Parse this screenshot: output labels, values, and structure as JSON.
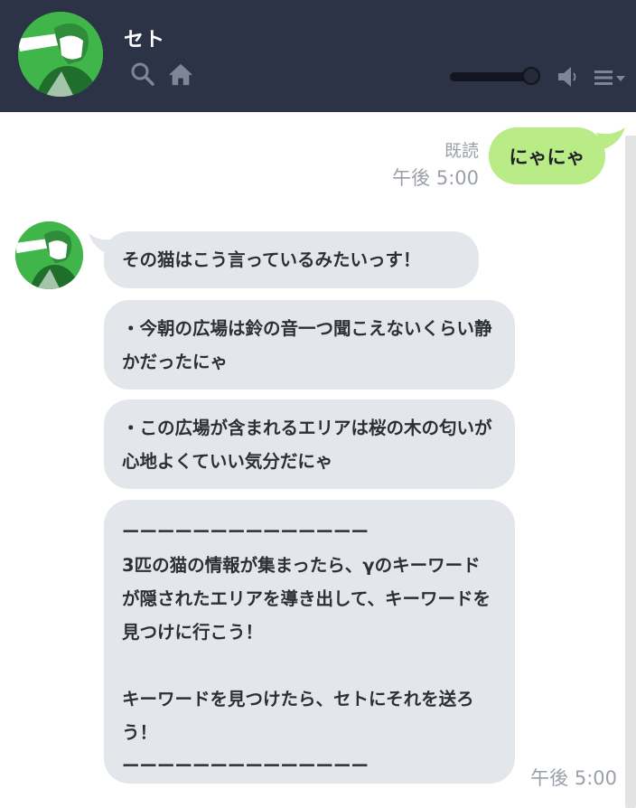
{
  "header": {
    "contact_name": "セト"
  },
  "sent": {
    "read_label": "既読",
    "time": "午後 5:00",
    "text": "にゃにゃ"
  },
  "received": {
    "messages": [
      "その猫はこう言っているみたいっす！",
      "・今朝の広場は鈴の音一つ聞こえないくらい静かだったにゃ",
      "・この広場が含まれるエリアは桜の木の匂いが心地よくていい気分だにゃ",
      "ーーーーーーーーーーーーーー\n3匹の猫の情報が集まったら、γのキーワードが隠されたエリアを導き出して、キーワードを見つけに行こう！\n\nキーワードを見つけたら、セトにそれを送ろう！\nーーーーーーーーーーーーーー"
    ],
    "time": "午後 5:00"
  },
  "icons": {
    "search": "search-icon",
    "home": "home-icon",
    "speaker": "speaker-icon",
    "menu": "menu-icon"
  },
  "colors": {
    "header_bg": "#2c3346",
    "sent_bubble": "#b9ec86",
    "received_bubble": "#e3e6ea",
    "avatar_green": "#3fb54a"
  }
}
